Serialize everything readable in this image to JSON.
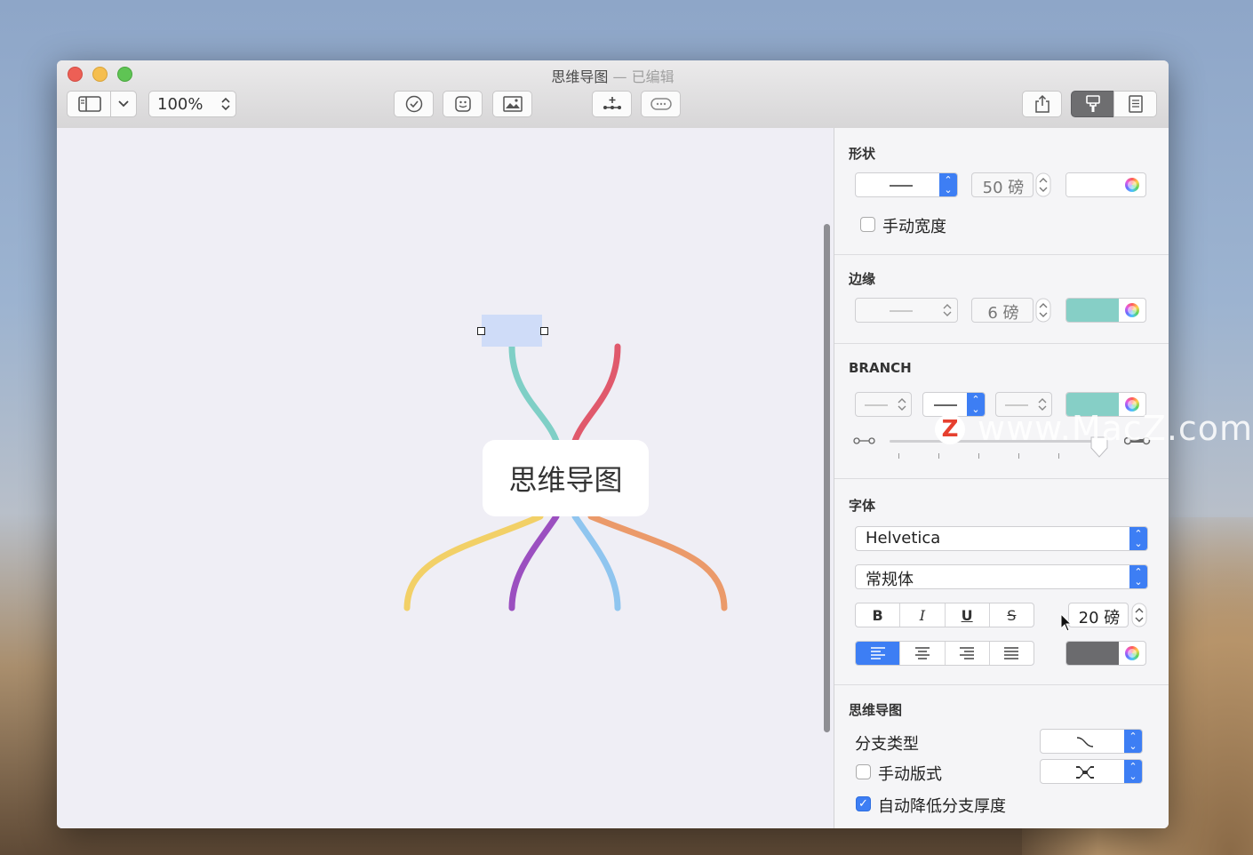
{
  "window": {
    "title": "思维导图",
    "title_separator": "—",
    "title_status": "已编辑"
  },
  "toolbar": {
    "zoom": "100%"
  },
  "canvas": {
    "central_topic": "思维导图",
    "branch_colors": [
      "#7fcfc6",
      "#e0596c",
      "#f2d067",
      "#9b4fc0",
      "#8fc5ef",
      "#eb9a6a"
    ]
  },
  "inspector": {
    "shape": {
      "title": "形状",
      "size": "50 磅",
      "manual_width": "手动宽度"
    },
    "border": {
      "title": "边缘",
      "size": "6 磅",
      "color": "#86cfc6"
    },
    "branch": {
      "title": "BRANCH",
      "color": "#86cfc6"
    },
    "font": {
      "title": "字体",
      "family": "Helvetica",
      "style": "常规体",
      "size": "20 磅",
      "bold": "B",
      "italic": "I",
      "underline": "U",
      "strike": "S",
      "color": "#6b6b6e"
    },
    "mindmap": {
      "title": "思维导图",
      "branch_type": "分支类型",
      "manual_layout": "手动版式",
      "auto_thinning": "自动降低分支厚度"
    }
  },
  "watermark": {
    "text": "www.MacZ.com",
    "logo": "Z"
  }
}
